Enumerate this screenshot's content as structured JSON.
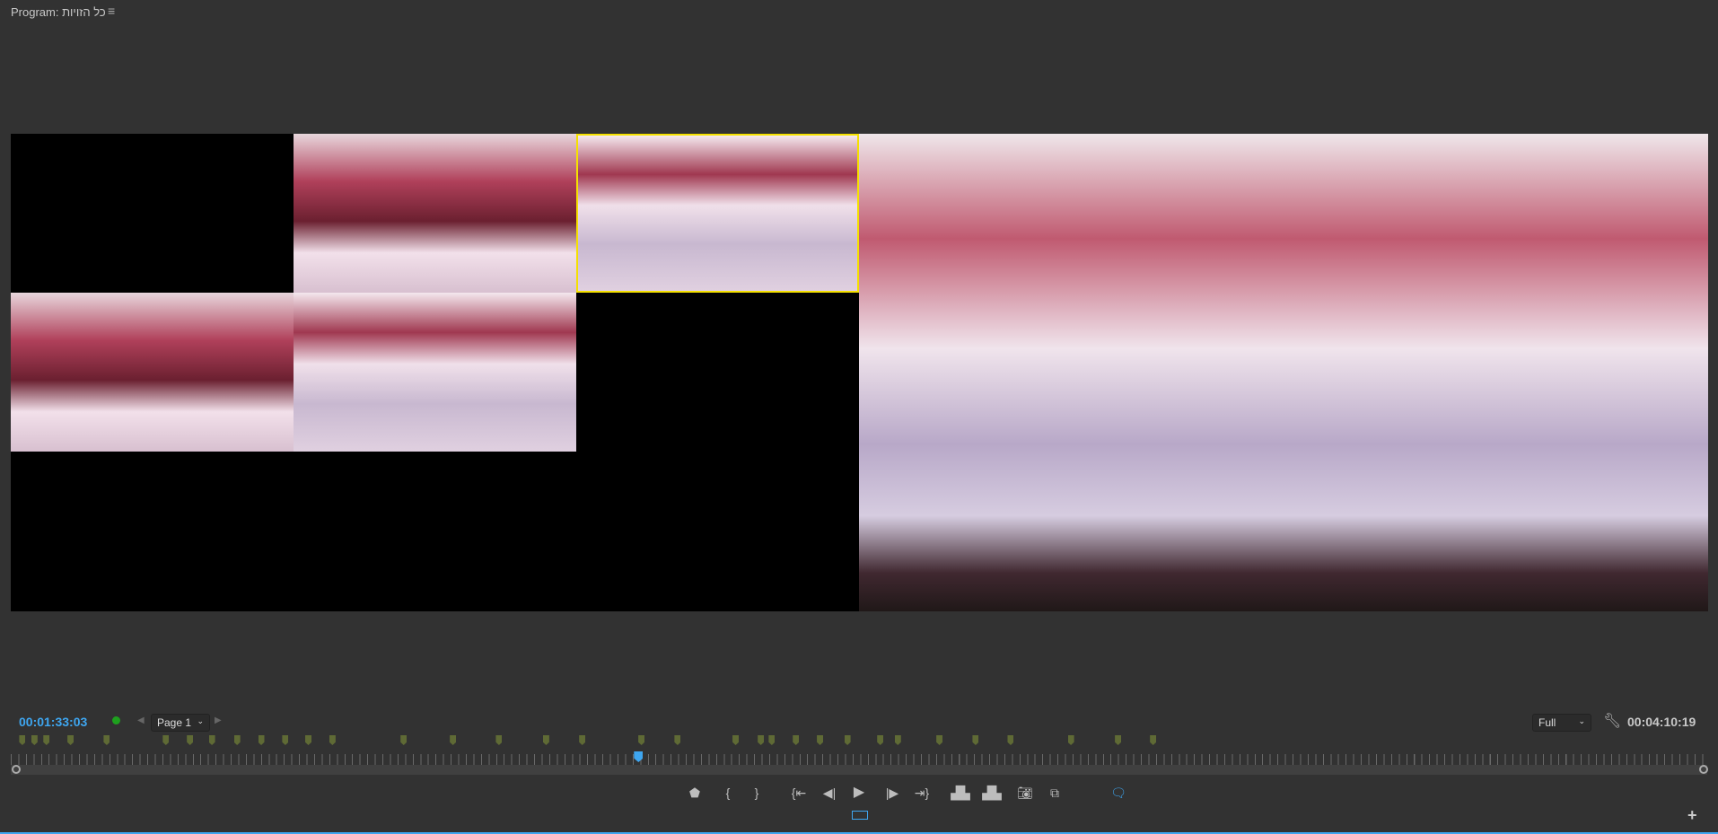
{
  "panel": {
    "title": "Program: כל הזויות",
    "menu_icon": "hamburger-icon"
  },
  "timecode_current": "00:01:33:03",
  "timecode_duration": "00:04:10:19",
  "page_selector": {
    "value": "Page 1"
  },
  "zoom_selector": {
    "value": "Full"
  },
  "playhead_fraction": 0.37,
  "marker_count": 34,
  "colors": {
    "accent": "#3ea6f0",
    "marker": "#5f6a35",
    "active_cam": "#f5e000",
    "status": "#1ea01e"
  },
  "transport": [
    "add-marker",
    "mark-in",
    "mark-out",
    "go-to-in",
    "step-back",
    "play",
    "step-forward",
    "go-to-out",
    "lift",
    "extract",
    "export-frame",
    "comparison-view",
    "captions"
  ]
}
